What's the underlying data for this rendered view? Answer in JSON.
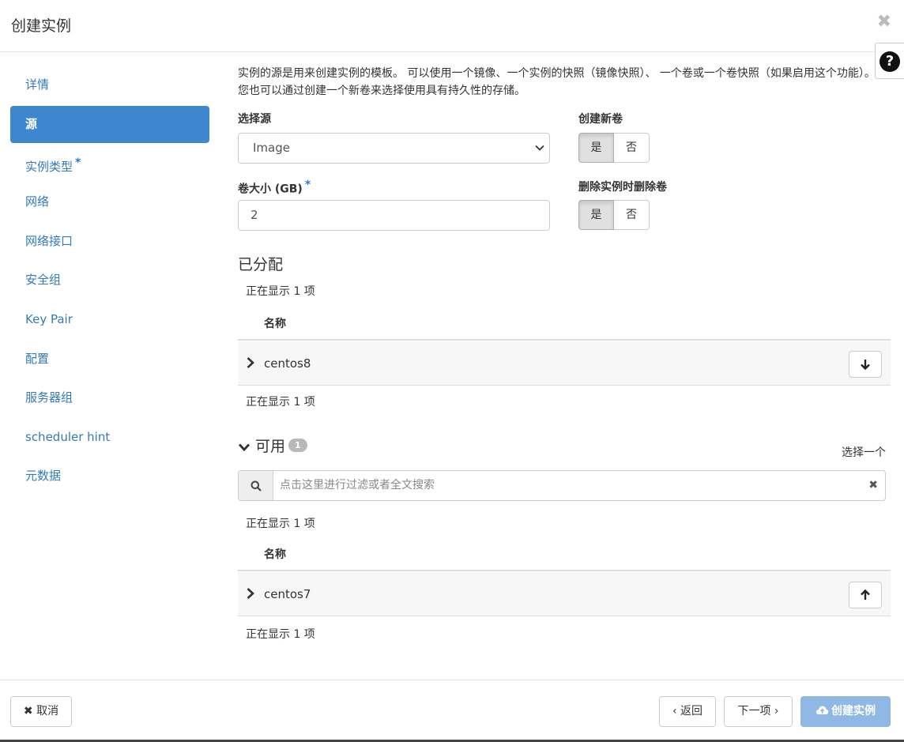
{
  "header": {
    "title": "创建实例",
    "close": "✖",
    "help": "?"
  },
  "nav": {
    "items": [
      {
        "label": "详情"
      },
      {
        "label": "源"
      },
      {
        "label": "实例类型",
        "required": "*"
      },
      {
        "label": "网络"
      },
      {
        "label": "网络接口"
      },
      {
        "label": "安全组"
      },
      {
        "label": "Key Pair"
      },
      {
        "label": "配置"
      },
      {
        "label": "服务器组"
      },
      {
        "label": "scheduler hint"
      },
      {
        "label": "元数据"
      }
    ]
  },
  "source": {
    "description": "实例的源是用来创建实例的模板。 可以使用一个镜像、一个实例的快照（镜像快照）、 一个卷或一个卷快照（如果启用这个功能）。 您也可以通过创建一个新卷来选择使用具有持久性的存储。",
    "select_source_label": "选择源",
    "select_source_value": "Image",
    "create_volume_label": "创建新卷",
    "create_volume_yes": "是",
    "create_volume_no": "否",
    "volume_size_label": "卷大小 (GB)",
    "volume_size_required": "*",
    "volume_size_value": "2",
    "delete_volume_label": "删除实例时删除卷",
    "delete_volume_yes": "是",
    "delete_volume_no": "否"
  },
  "allocated": {
    "title": "已分配",
    "count_top": "正在显示 1 项",
    "col_name": "名称",
    "rows": [
      {
        "name": "centos8"
      }
    ],
    "count_bottom": "正在显示 1 项"
  },
  "available": {
    "title": "可用",
    "badge": "1",
    "select_one": "选择一个",
    "search_placeholder": "点击这里进行过滤或者全文搜索",
    "count_top": "正在显示 1 项",
    "col_name": "名称",
    "rows": [
      {
        "name": "centos7"
      }
    ],
    "count_bottom": "正在显示 1 项"
  },
  "footer": {
    "cancel": "✖ 取消",
    "back": "‹ 返回",
    "next": "下一项 ›",
    "create": "创建实例"
  },
  "colors": {
    "accent": "#3e87cf",
    "link": "#337ab7",
    "primary_disabled": "#8fb9e4"
  }
}
